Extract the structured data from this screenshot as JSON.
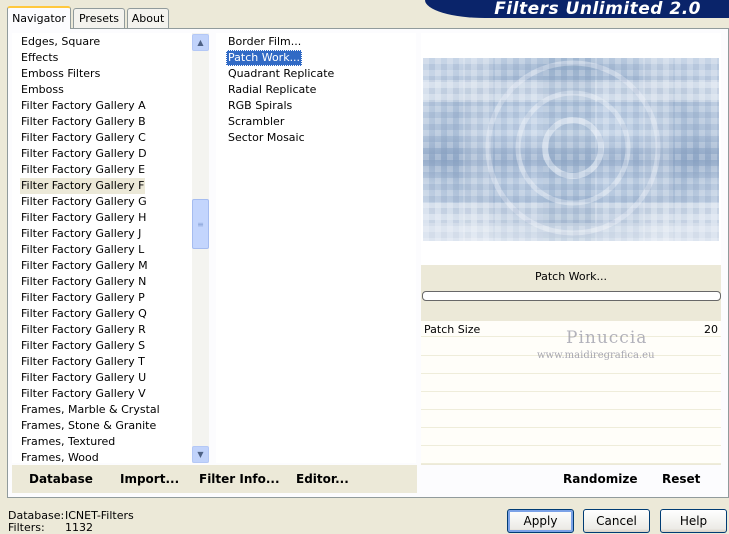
{
  "tabs": [
    {
      "label": "Navigator",
      "active": true
    },
    {
      "label": "Presets",
      "active": false
    },
    {
      "label": "About",
      "active": false
    }
  ],
  "banner": {
    "title": "Filters Unlimited 2.0",
    "color": "#0a246a"
  },
  "categories": {
    "items": [
      "Edges, Square",
      "Effects",
      "Emboss Filters",
      "Emboss",
      "Filter Factory Gallery A",
      "Filter Factory Gallery B",
      "Filter Factory Gallery C",
      "Filter Factory Gallery D",
      "Filter Factory Gallery E",
      "Filter Factory Gallery F",
      "Filter Factory Gallery G",
      "Filter Factory Gallery H",
      "Filter Factory Gallery J",
      "Filter Factory Gallery L",
      "Filter Factory Gallery M",
      "Filter Factory Gallery N",
      "Filter Factory Gallery P",
      "Filter Factory Gallery Q",
      "Filter Factory Gallery R",
      "Filter Factory Gallery S",
      "Filter Factory Gallery T",
      "Filter Factory Gallery U",
      "Filter Factory Gallery V",
      "Frames, Marble & Crystal",
      "Frames, Stone & Granite",
      "Frames, Textured",
      "Frames, Wood"
    ],
    "selected": "Filter Factory Gallery F"
  },
  "filters": {
    "items": [
      "Border Film...",
      "Patch Work...",
      "Quadrant Replicate",
      "Radial Replicate",
      "RGB Spirals",
      "Scrambler",
      "Sector Mosaic"
    ],
    "selected": "Patch Work..."
  },
  "preview": {
    "filter_name": "Patch Work...",
    "colors": {
      "light": "#e8eef6",
      "mid": "#a9bdd6",
      "dark": "#6f8bb2"
    }
  },
  "parameters": [
    {
      "label": "Patch Size",
      "value": "20"
    }
  ],
  "watermark": {
    "name": "Pinuccia",
    "url": "www.maidiregrafica.eu"
  },
  "toolbar": {
    "database": "Database",
    "import": "Import...",
    "filter_info": "Filter Info...",
    "editor": "Editor...",
    "randomize": "Randomize",
    "reset": "Reset"
  },
  "status": {
    "database_label": "Database:",
    "database_value": "ICNET-Filters",
    "filters_label": "Filters:",
    "filters_value": "1132"
  },
  "buttons": {
    "apply": "Apply",
    "cancel": "Cancel",
    "help": "Help"
  },
  "icons": {
    "scroll_up": "chevron-up-icon",
    "scroll_down": "chevron-down-icon",
    "thumb_grip": "grip-icon"
  }
}
